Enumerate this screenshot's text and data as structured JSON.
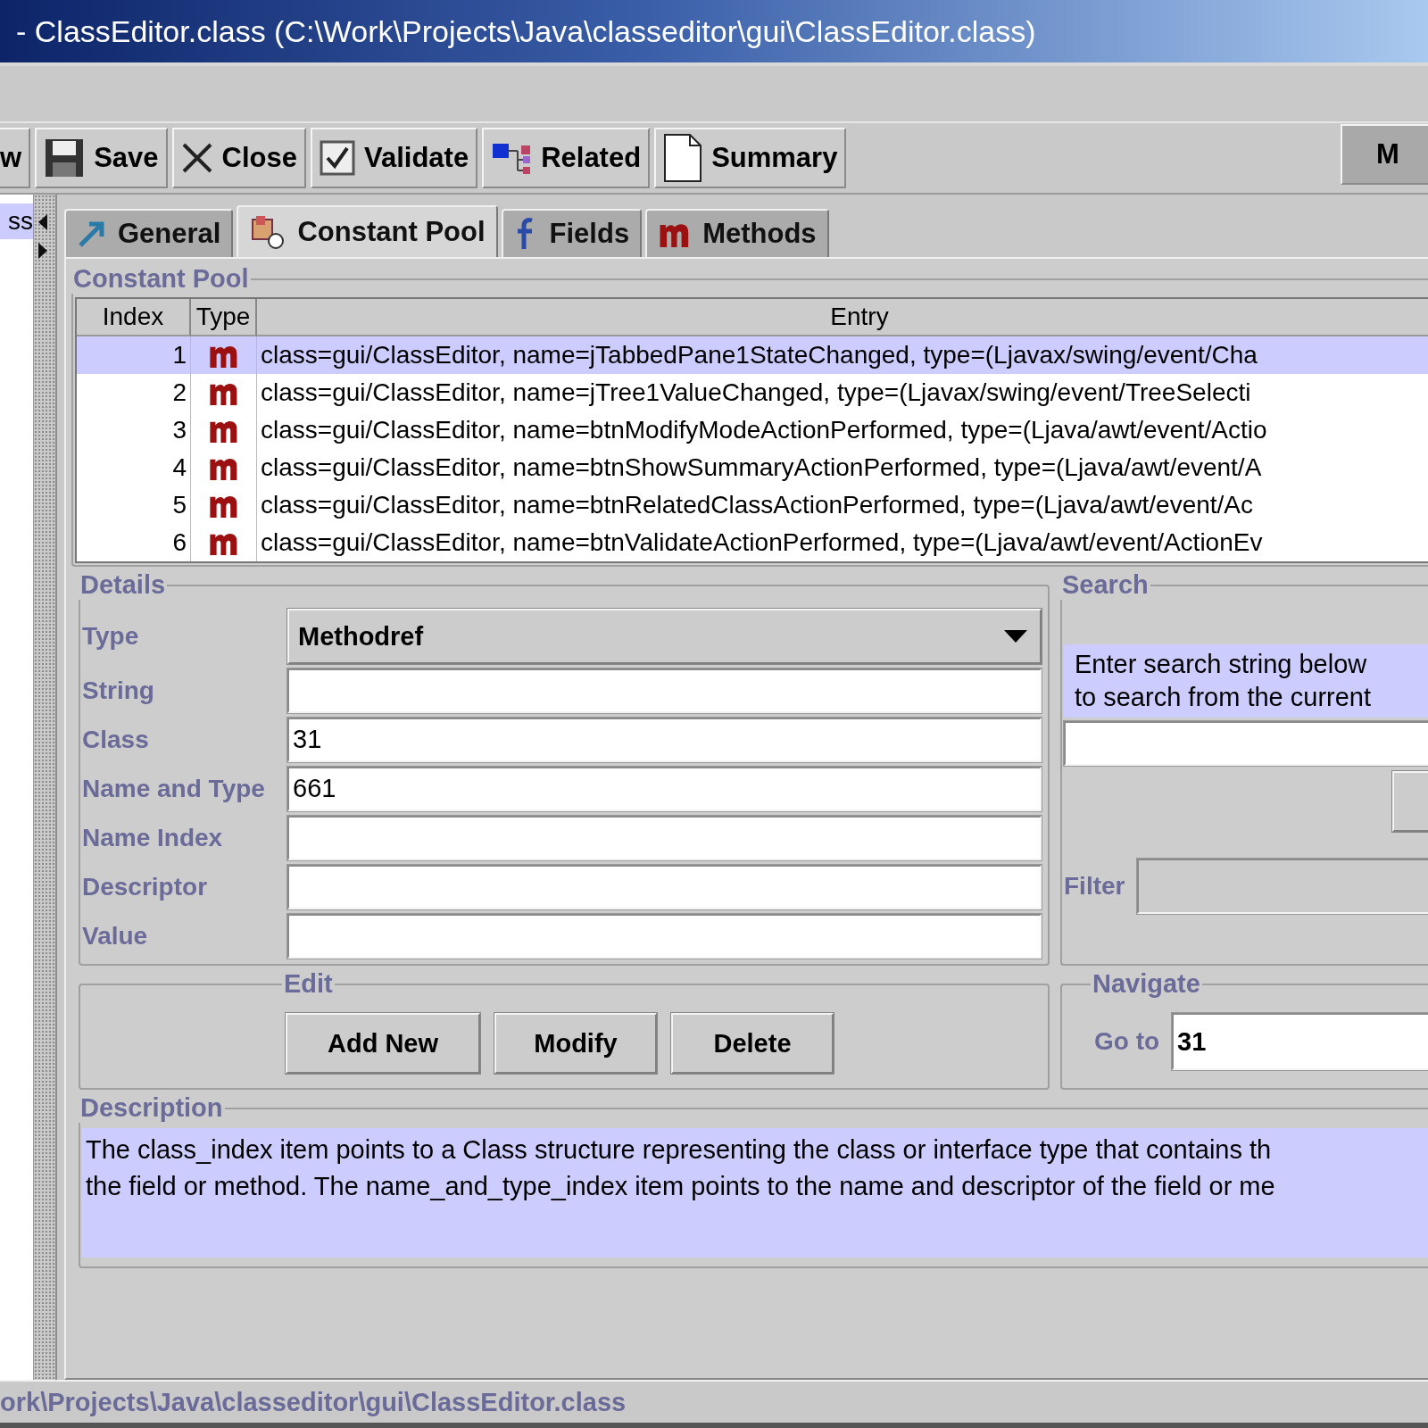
{
  "window": {
    "title": "- ClassEditor.class (C:\\Work\\Projects\\Java\\classeditor\\gui\\ClassEditor.class)"
  },
  "toolbar": [
    {
      "label": "w",
      "kind": "none"
    },
    {
      "label": "Save",
      "kind": "save"
    },
    {
      "label": "Close",
      "kind": "close"
    },
    {
      "label": "Validate",
      "kind": "validate"
    },
    {
      "label": "Related",
      "kind": "related"
    },
    {
      "label": "Summary",
      "kind": "summary"
    }
  ],
  "toolbar_right": {
    "label": "M"
  },
  "tree": {
    "items": [
      {
        "label": "ss",
        "selected": true
      }
    ]
  },
  "tabs": [
    {
      "label": "General",
      "kind": "general",
      "selected": false
    },
    {
      "label": "Constant Pool",
      "kind": "pool",
      "selected": true
    },
    {
      "label": "Fields",
      "kind": "fields",
      "selected": false
    },
    {
      "label": "Methods",
      "kind": "methods",
      "selected": false
    }
  ],
  "constant_pool": {
    "title": "Constant Pool",
    "columns": [
      "Index",
      "Type",
      "Entry"
    ],
    "rows": [
      {
        "index": "1",
        "kind": "method",
        "entry": "class=gui/ClassEditor, name=jTabbedPane1StateChanged, type=(Ljavax/swing/event/Cha",
        "selected": true
      },
      {
        "index": "2",
        "kind": "method",
        "entry": "class=gui/ClassEditor, name=jTree1ValueChanged, type=(Ljavax/swing/event/TreeSelecti",
        "selected": false
      },
      {
        "index": "3",
        "kind": "method",
        "entry": "class=gui/ClassEditor, name=btnModifyModeActionPerformed, type=(Ljava/awt/event/Actio",
        "selected": false
      },
      {
        "index": "4",
        "kind": "method",
        "entry": "class=gui/ClassEditor, name=btnShowSummaryActionPerformed, type=(Ljava/awt/event/A",
        "selected": false
      },
      {
        "index": "5",
        "kind": "method",
        "entry": "class=gui/ClassEditor, name=btnRelatedClassActionPerformed, type=(Ljava/awt/event/Ac",
        "selected": false
      },
      {
        "index": "6",
        "kind": "method",
        "entry": "class=gui/ClassEditor, name=btnValidateActionPerformed, type=(Ljava/awt/event/ActionEv",
        "selected": false
      }
    ]
  },
  "details": {
    "title": "Details",
    "fields": [
      {
        "label": "Type",
        "kind": "dropdown",
        "value": "Methodref"
      },
      {
        "label": "String",
        "kind": "text"
      },
      {
        "label": "Class",
        "kind": "text",
        "value": "31"
      },
      {
        "label": "Name and Type",
        "kind": "text",
        "value": "661"
      },
      {
        "label": "Name Index",
        "kind": "text"
      },
      {
        "label": "Descriptor",
        "kind": "text"
      },
      {
        "label": "Value",
        "kind": "text"
      }
    ]
  },
  "search": {
    "title": "Search",
    "hint_lines": [
      "Enter search string below",
      "to search from the current"
    ],
    "filter_label": "Filter"
  },
  "edit": {
    "title": "Edit",
    "buttons": [
      "Add New",
      "Modify",
      "Delete"
    ]
  },
  "navigate": {
    "title": "Navigate",
    "label": "Go to",
    "value": "31"
  },
  "description": {
    "title": "Description",
    "lines": [
      "The class_index item points to a Class structure representing the class or interface type that contains th",
      "the field or method. The name_and_type_index item points to the name and descriptor of the field or me"
    ]
  },
  "status_bar": {
    "text": "ork\\Projects\\Java\\classeditor\\gui\\ClassEditor.class"
  }
}
